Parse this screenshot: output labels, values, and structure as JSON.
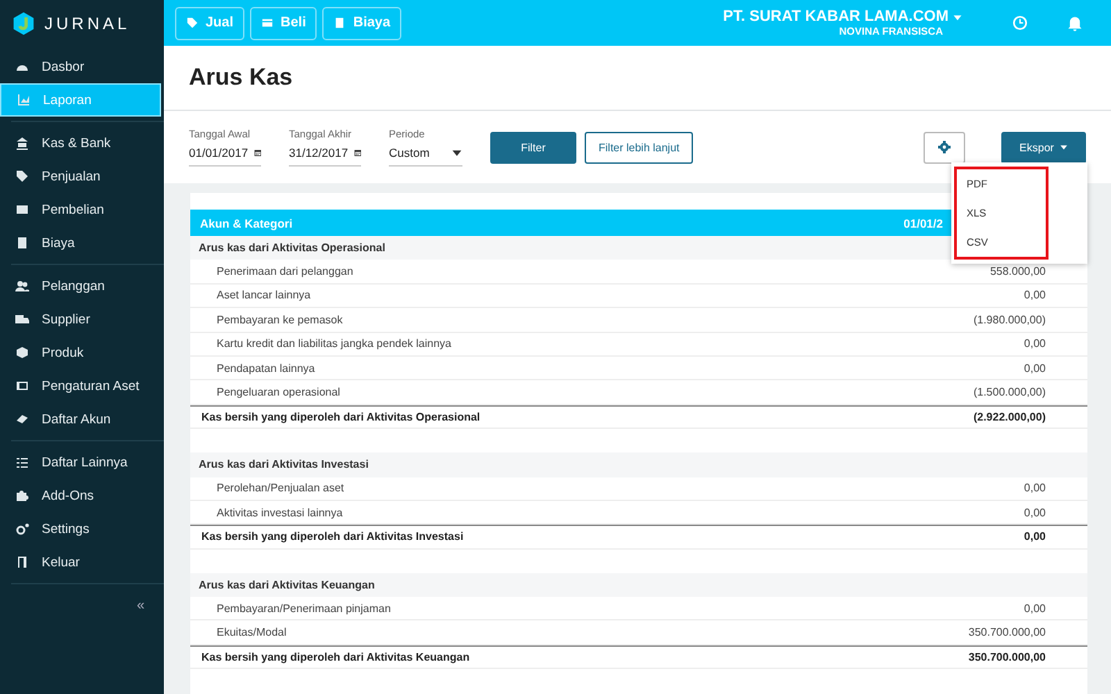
{
  "app": {
    "logo": "JURNAL",
    "collapse": "«"
  },
  "sidebar": {
    "groups": [
      [
        {
          "label": "Dasbor",
          "selected": false
        },
        {
          "label": "Laporan",
          "selected": true
        }
      ],
      [
        {
          "label": "Kas & Bank",
          "selected": false
        },
        {
          "label": "Penjualan",
          "selected": false
        },
        {
          "label": "Pembelian",
          "selected": false
        },
        {
          "label": "Biaya",
          "selected": false
        }
      ],
      [
        {
          "label": "Pelanggan",
          "selected": false
        },
        {
          "label": "Supplier",
          "selected": false
        },
        {
          "label": "Produk",
          "selected": false
        },
        {
          "label": "Pengaturan Aset",
          "selected": false
        },
        {
          "label": "Daftar Akun",
          "selected": false
        }
      ],
      [
        {
          "label": "Daftar Lainnya",
          "selected": false
        },
        {
          "label": "Add-Ons",
          "selected": false
        },
        {
          "label": "Settings",
          "selected": false
        },
        {
          "label": "Keluar",
          "selected": false
        }
      ]
    ]
  },
  "topbar": {
    "buttons": [
      "Jual",
      "Beli",
      "Biaya"
    ],
    "company": "PT. SURAT KABAR LAMA.COM",
    "user": "NOVINA FRANSISCA"
  },
  "page": {
    "title": "Arus Kas"
  },
  "filters": {
    "start": {
      "label": "Tanggal Awal",
      "value": "01/01/2017"
    },
    "end": {
      "label": "Tanggal Akhir",
      "value": "31/12/2017"
    },
    "period": {
      "label": "Periode",
      "value": "Custom"
    },
    "filter_button": "Filter",
    "more_button": "Filter lebih lanjut",
    "export_button": "Ekspor"
  },
  "export_menu": {
    "items": [
      "PDF",
      "XLS",
      "CSV"
    ],
    "highlighted": true
  },
  "table": {
    "columns": [
      "Akun & Kategori",
      "01/01/2"
    ],
    "sections": [
      {
        "title": "Arus kas dari Aktivitas Operasional",
        "rows": [
          {
            "label": "Penerimaan dari pelanggan",
            "value": "558.000,00"
          },
          {
            "label": "Aset lancar lainnya",
            "value": "0,00"
          },
          {
            "label": "Pembayaran ke pemasok",
            "value": "(1.980.000,00)"
          },
          {
            "label": "Kartu kredit dan liabilitas jangka pendek lainnya",
            "value": "0,00"
          },
          {
            "label": "Pendapatan lainnya",
            "value": "0,00"
          },
          {
            "label": "Pengeluaran operasional",
            "value": "(1.500.000,00)"
          }
        ],
        "total": {
          "label": "Kas bersih yang diperoleh dari Aktivitas Operasional",
          "value": "(2.922.000,00)"
        }
      },
      {
        "title": "Arus kas dari Aktivitas Investasi",
        "rows": [
          {
            "label": "Perolehan/Penjualan aset",
            "value": "0,00"
          },
          {
            "label": "Aktivitas investasi lainnya",
            "value": "0,00"
          }
        ],
        "total": {
          "label": "Kas bersih yang diperoleh dari Aktivitas Investasi",
          "value": "0,00"
        }
      },
      {
        "title": "Arus kas dari Aktivitas Keuangan",
        "rows": [
          {
            "label": "Pembayaran/Penerimaan pinjaman",
            "value": "0,00"
          },
          {
            "label": "Ekuitas/Modal",
            "value": "350.700.000,00"
          }
        ],
        "total": {
          "label": "Kas bersih yang diperoleh dari Aktivitas Keuangan",
          "value": "350.700.000,00"
        }
      }
    ]
  }
}
